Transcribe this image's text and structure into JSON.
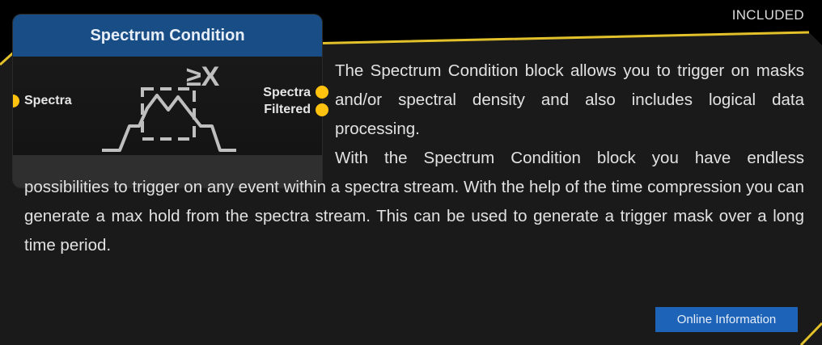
{
  "badge": {
    "text": "INCLUDED"
  },
  "block": {
    "title": "Spectrum Condition",
    "input_port": "Spectra",
    "output_ports": [
      "Spectra",
      "Filtered"
    ],
    "symbol_text": "≥X"
  },
  "description": {
    "paragraph1": "The Spectrum Condition block allows you to trigger on masks and/or spectral density and also includes logical data processing.",
    "paragraph2": "With the Spectrum Condition block you have endless possibilities to trigger on any event within a spectra stream. With the help of the time compression you can generate a max hold from the spectra stream. This can be used to generate a trigger mask over a long time period."
  },
  "link": {
    "label": "Online Information"
  },
  "colors": {
    "accent": "#ffc20e",
    "header_blue": "#184d86",
    "button_blue": "#1d63b8",
    "panel": "#1a1a1a"
  }
}
